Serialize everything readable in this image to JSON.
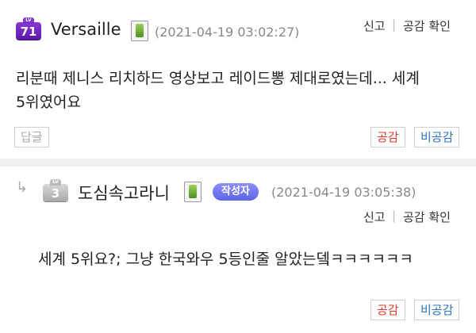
{
  "comment1": {
    "level": "71",
    "level_tag": "LV",
    "nickname": "Versaille",
    "date": "(2021-04-19 03:02:27)",
    "report_label": "신고",
    "sep": "|",
    "likes_label": "공감 확인",
    "text_line1": "리분때 제니스 리치하드 영상보고 레이드뽕 제대로였는데... 세계",
    "text_line2": "5위였어요",
    "reply_label": "답글",
    "up_label": "공감",
    "down_label": "비공감"
  },
  "comment2": {
    "reply_arrow": "↳",
    "level": "3",
    "level_tag": "LV",
    "nickname": "도심속고라니",
    "author_tag": "작성자",
    "date": "(2021-04-19 03:05:38)",
    "report_label": "신고",
    "sep": "|",
    "likes_label": "공감 확인",
    "text": "세계 5위요?; 그냥 한국와우 5등인줄 알았는뎈ㅋㅋㅋㅋㅋㅋ",
    "up_label": "공감",
    "down_label": "비공감"
  },
  "colors": {
    "badge_purple": "#6a1fc1",
    "author_tag": "#6b6ff0",
    "up_red": "#d93a2a",
    "down_blue": "#2d72b8"
  }
}
